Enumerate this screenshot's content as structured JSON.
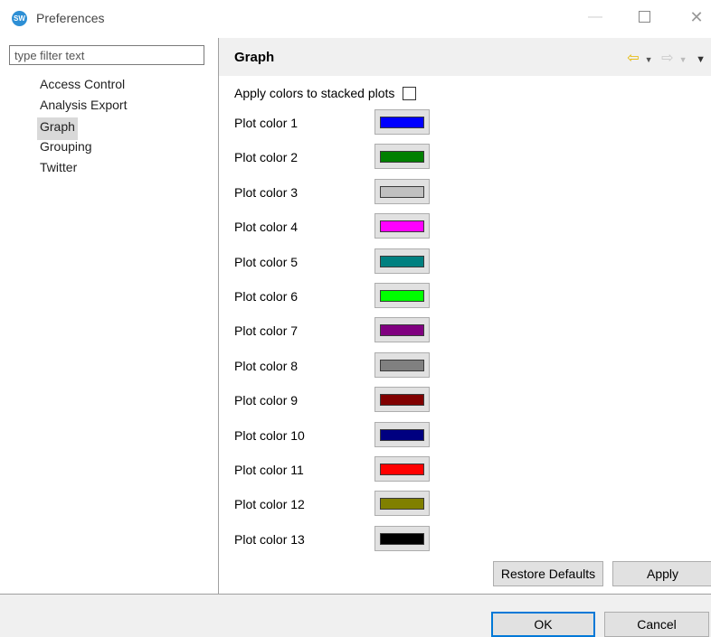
{
  "window": {
    "title": "Preferences",
    "icon_text": "SW",
    "min_glyph": "—",
    "close_glyph": "✕"
  },
  "filter": {
    "placeholder": "type filter text"
  },
  "tree": {
    "items": [
      {
        "label": "Access Control",
        "selected": false
      },
      {
        "label": "Analysis Export",
        "selected": false
      },
      {
        "label": "Graph",
        "selected": true
      },
      {
        "label": "Grouping",
        "selected": false
      },
      {
        "label": "Twitter",
        "selected": false
      }
    ]
  },
  "page": {
    "title": "Graph",
    "nav": {
      "back_glyph": "⇦",
      "forward_glyph": "⇨",
      "dropdown_glyph": "▼",
      "menu_glyph": "▼"
    },
    "stacked": {
      "label": "Apply colors to stacked plots",
      "checked": false
    },
    "plot_colors": [
      {
        "label": "Plot color 1",
        "color": "#0000ff"
      },
      {
        "label": "Plot color 2",
        "color": "#008000"
      },
      {
        "label": "Plot color 3",
        "color": "#c0c0c0"
      },
      {
        "label": "Plot color 4",
        "color": "#ff00ff"
      },
      {
        "label": "Plot color 5",
        "color": "#008080"
      },
      {
        "label": "Plot color 6",
        "color": "#00ff00"
      },
      {
        "label": "Plot color 7",
        "color": "#800080"
      },
      {
        "label": "Plot color 8",
        "color": "#808080"
      },
      {
        "label": "Plot color 9",
        "color": "#800000"
      },
      {
        "label": "Plot color 10",
        "color": "#000080"
      },
      {
        "label": "Plot color 11",
        "color": "#ff0000"
      },
      {
        "label": "Plot color 12",
        "color": "#808000"
      },
      {
        "label": "Plot color 13",
        "color": "#000000"
      }
    ],
    "restore_label": "Restore Defaults",
    "apply_label": "Apply"
  },
  "footer": {
    "ok_label": "OK",
    "cancel_label": "Cancel"
  }
}
